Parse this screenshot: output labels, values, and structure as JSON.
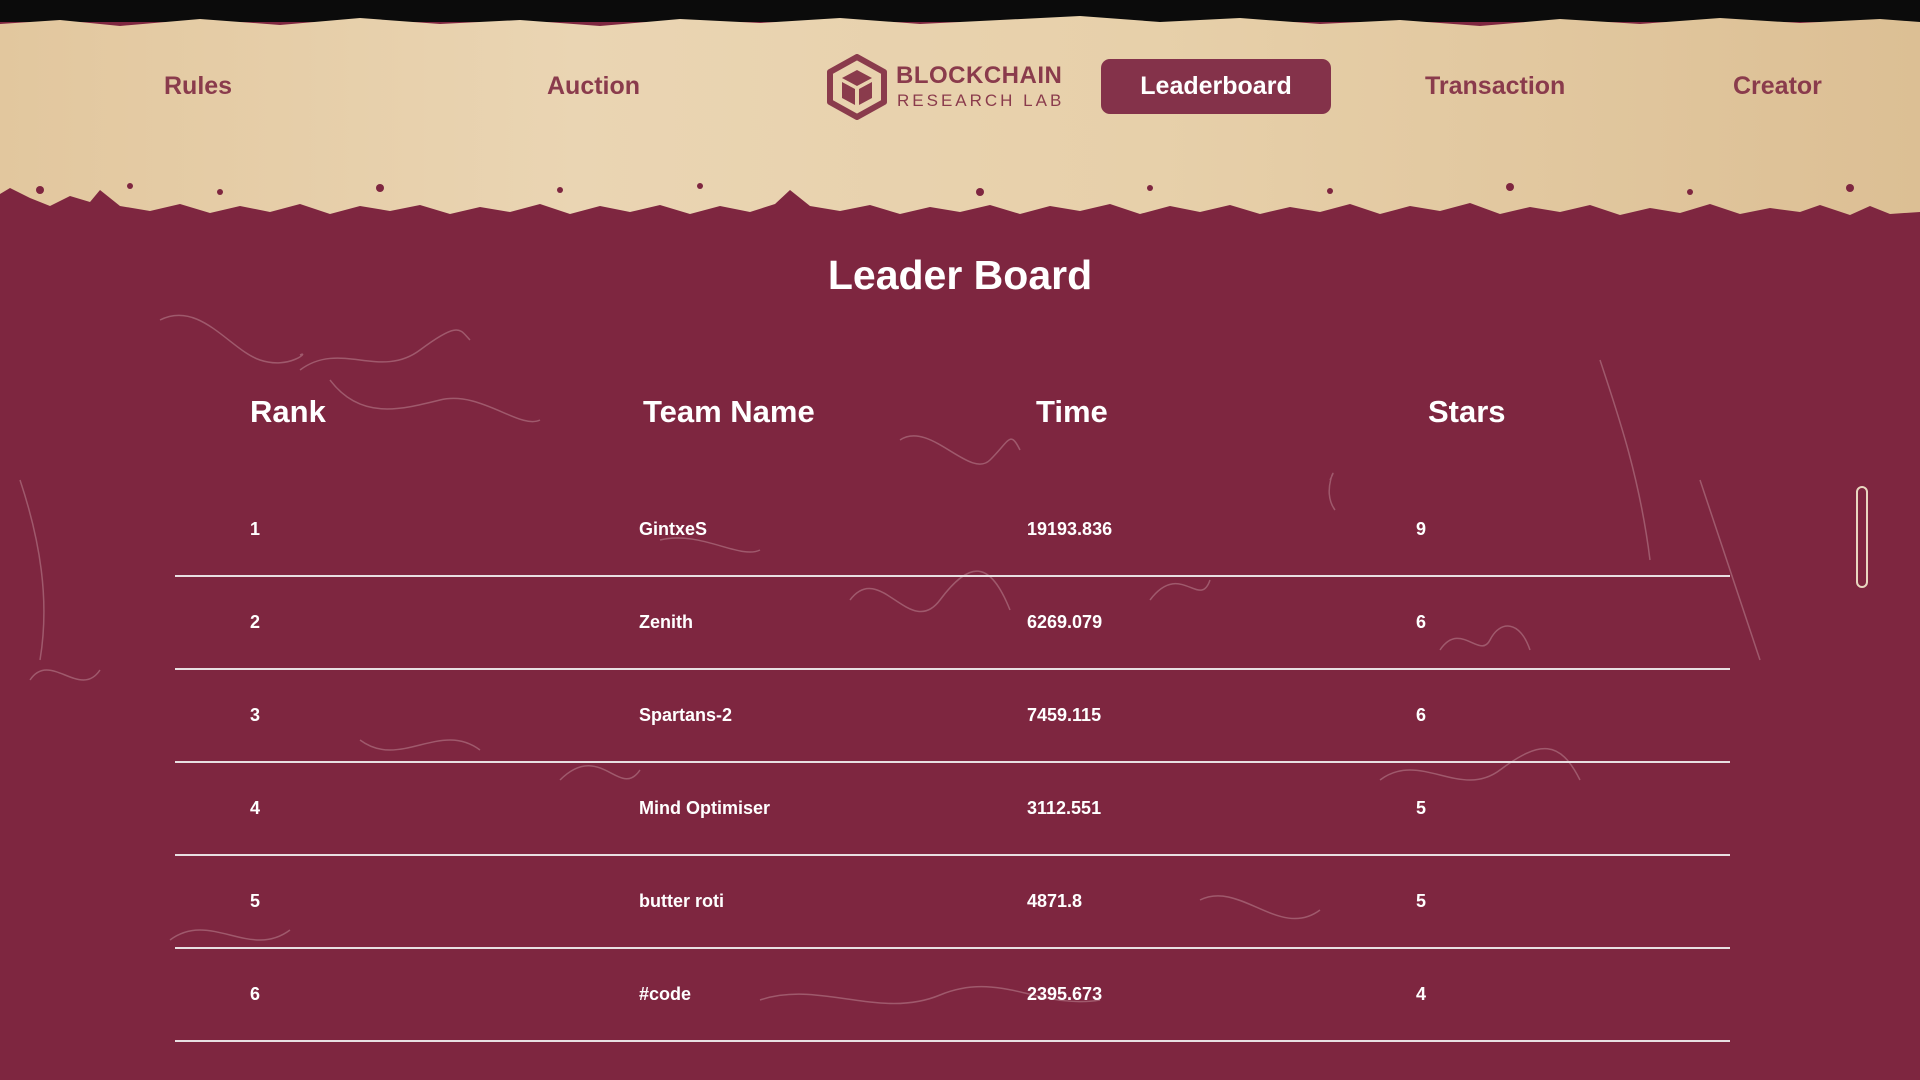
{
  "nav": {
    "rules": "Rules",
    "auction": "Auction",
    "leaderboard": "Leaderboard",
    "transaction": "Transaction",
    "creator": "Creator"
  },
  "logo": {
    "title": "BLOCKCHAIN",
    "subtitle": "RESEARCH LAB",
    "icon": "cube-icon"
  },
  "board": {
    "title": "Leader Board",
    "columns": [
      "Rank",
      "Team Name",
      "Time",
      "Stars"
    ],
    "rows": [
      {
        "rank": "1",
        "team": "GintxeS",
        "time": "19193.836",
        "stars": "9"
      },
      {
        "rank": "2",
        "team": "Zenith",
        "time": "6269.079",
        "stars": "6"
      },
      {
        "rank": "3",
        "team": "Spartans-2",
        "time": "7459.115",
        "stars": "6"
      },
      {
        "rank": "4",
        "team": "Mind Optimiser",
        "time": "3112.551",
        "stars": "5"
      },
      {
        "rank": "5",
        "team": "butter roti",
        "time": "4871.8",
        "stars": "5"
      },
      {
        "rank": "6",
        "team": "#code",
        "time": "2395.673",
        "stars": "4"
      }
    ]
  },
  "colors": {
    "background": "#7e2640",
    "parchment": "#e6cfa8",
    "accent": "#8a3b4c",
    "active_button": "#84324a"
  }
}
